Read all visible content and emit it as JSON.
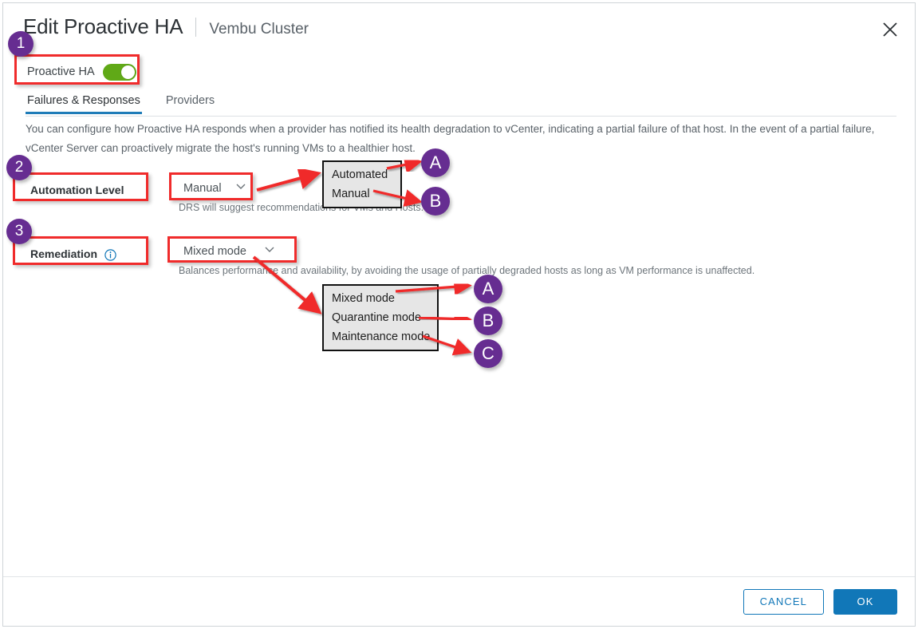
{
  "header": {
    "title": "Edit Proactive HA",
    "subtitle": "Vembu Cluster",
    "close_icon": "close-icon"
  },
  "proactive_ha": {
    "label": "Proactive HA",
    "toggle_state": "on",
    "toggle_color": "#60a917"
  },
  "tabs": [
    {
      "label": "Failures & Responses",
      "active": true
    },
    {
      "label": "Providers",
      "active": false
    }
  ],
  "intro_text": "You can configure how Proactive HA responds when a provider has notified its health degradation to vCenter, indicating a partial failure of that host. In the event of a partial failure, vCenter Server can proactively migrate the host's running VMs to a healthier host.",
  "automation": {
    "label": "Automation Level",
    "selected": "Manual",
    "help": "DRS will suggest recommendations for VMs and Hosts.",
    "options": [
      "Automated",
      "Manual"
    ]
  },
  "remediation": {
    "label": "Remediation",
    "info_icon": "info-circle-icon",
    "selected": "Mixed mode",
    "help": "Balances performance and availability, by avoiding the usage of partially degraded hosts as long as VM performance is unaffected.",
    "options": [
      "Mixed mode",
      "Quarantine mode",
      "Maintenance mode"
    ]
  },
  "footer": {
    "cancel_label": "CANCEL",
    "ok_label": "OK",
    "accent_color": "#1177b8"
  },
  "annotations": {
    "highlight_color": "#f02b2b",
    "badge_color": "#662d91",
    "numbers": [
      "1",
      "2",
      "3"
    ],
    "automation_letters": [
      "A",
      "B"
    ],
    "remediation_letters": [
      "A",
      "B",
      "C"
    ]
  }
}
